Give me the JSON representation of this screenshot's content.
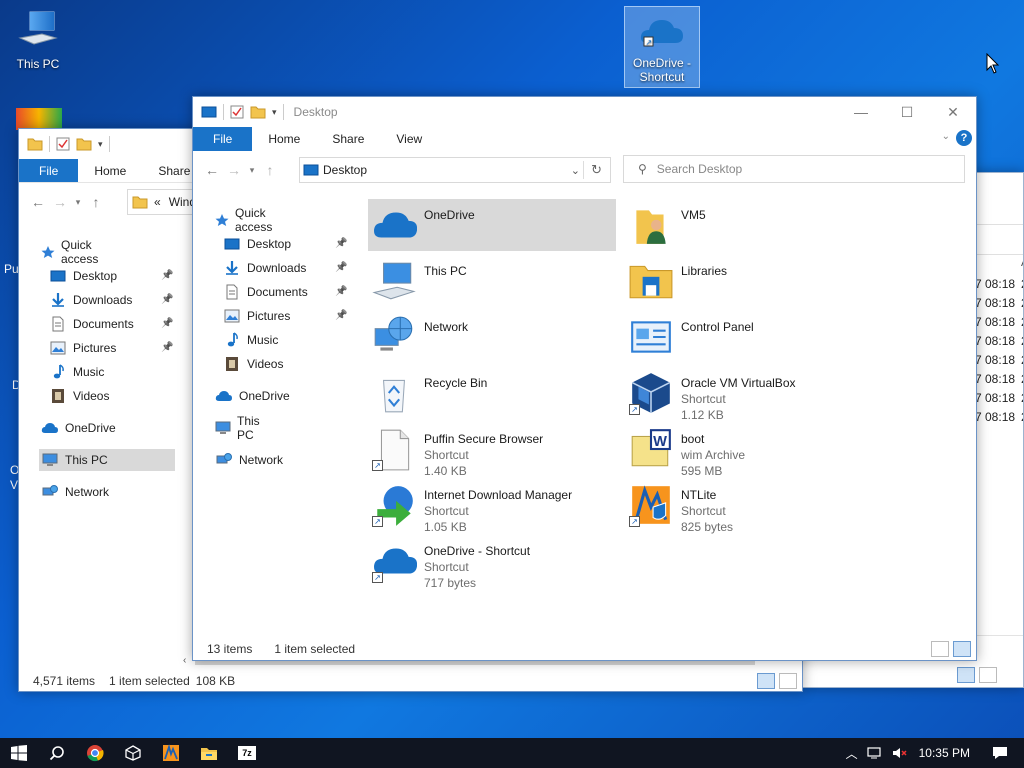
{
  "desktop": {
    "icons": [
      {
        "label": "This PC",
        "icon": "monitor-icon"
      },
      {
        "label": "OneDrive - Shortcut",
        "icon": "cloud-icon"
      }
    ],
    "partial_labels": [
      "Pu",
      "D",
      "O",
      "V"
    ]
  },
  "back_window": {
    "tabs": [
      "File",
      "Home",
      "Share"
    ],
    "address": "Wind",
    "address_prefix": "«",
    "nav": {
      "quick_access": "Quick access",
      "items": [
        {
          "label": "Desktop",
          "pinned": true
        },
        {
          "label": "Downloads",
          "pinned": true
        },
        {
          "label": "Documents",
          "pinned": true
        },
        {
          "label": "Pictures",
          "pinned": true
        },
        {
          "label": "Music",
          "pinned": false
        },
        {
          "label": "Videos",
          "pinned": false
        }
      ],
      "onedrive": "OneDrive",
      "this_pc": "This PC",
      "network": "Network"
    },
    "status": {
      "count": "4,571 items",
      "selected": "1 item selected",
      "size": "108 KB"
    }
  },
  "right_window": {
    "header_partial": "A",
    "times": [
      "7 08:18",
      "7 08:18",
      "7 08:18",
      "7 08:18",
      "7 08:18",
      "7 08:18",
      "7 08:18",
      "7 08:18"
    ],
    "tails": [
      "2",
      "2",
      "2",
      "2",
      "2",
      "2",
      "2",
      "2"
    ]
  },
  "main_window": {
    "title": "Desktop",
    "tabs": {
      "file": "File",
      "home": "Home",
      "share": "Share",
      "view": "View"
    },
    "help": "?",
    "address": "Desktop",
    "search_placeholder": "Search Desktop",
    "nav": {
      "quick_access": "Quick access",
      "items": [
        {
          "label": "Desktop",
          "pinned": true
        },
        {
          "label": "Downloads",
          "pinned": true
        },
        {
          "label": "Documents",
          "pinned": true
        },
        {
          "label": "Pictures",
          "pinned": true
        },
        {
          "label": "Music",
          "pinned": false
        },
        {
          "label": "Videos",
          "pinned": false
        }
      ],
      "onedrive": "OneDrive",
      "this_pc": "This PC",
      "network": "Network"
    },
    "items_left": [
      {
        "name": "OneDrive",
        "type": "",
        "size": "",
        "icon": "cloud-icon",
        "selected": true
      },
      {
        "name": "This PC",
        "type": "",
        "size": "",
        "icon": "monitor-icon"
      },
      {
        "name": "Network",
        "type": "",
        "size": "",
        "icon": "network-icon"
      },
      {
        "name": "Recycle Bin",
        "type": "",
        "size": "",
        "icon": "recycle-bin-icon"
      },
      {
        "name": "Puffin Secure Browser",
        "type": "Shortcut",
        "size": "1.40 KB",
        "icon": "blank-file-icon",
        "shortcut": true
      },
      {
        "name": "Internet Download Manager",
        "type": "Shortcut",
        "size": "1.05 KB",
        "icon": "idm-icon",
        "shortcut": true
      },
      {
        "name": "OneDrive - Shortcut",
        "type": "Shortcut",
        "size": "717 bytes",
        "icon": "cloud-icon",
        "shortcut": true
      }
    ],
    "items_right": [
      {
        "name": "VM5",
        "type": "",
        "size": "",
        "icon": "user-folder-icon"
      },
      {
        "name": "Libraries",
        "type": "",
        "size": "",
        "icon": "libraries-icon"
      },
      {
        "name": "Control Panel",
        "type": "",
        "size": "",
        "icon": "control-panel-icon"
      },
      {
        "name": "Oracle VM VirtualBox",
        "type": "Shortcut",
        "size": "1.12 KB",
        "icon": "virtualbox-icon",
        "shortcut": true
      },
      {
        "name": "boot",
        "type": "wim Archive",
        "size": "595 MB",
        "icon": "wim-archive-icon"
      },
      {
        "name": "NTLite",
        "type": "Shortcut",
        "size": "825 bytes",
        "icon": "ntlite-icon",
        "shortcut": true
      }
    ],
    "status": {
      "count": "13 items",
      "selected": "1 item selected"
    }
  },
  "taskbar": {
    "apps": [
      "start-icon",
      "search-icon",
      "chrome-icon",
      "virtualbox-icon",
      "ntlite-icon",
      "file-explorer-icon",
      "7zip-icon"
    ],
    "seven_zip_label": "7z",
    "clock": "10:35 PM"
  },
  "colors": {
    "accent": "#1a73c8",
    "selection": "#d9d9d9",
    "taskbar": "#101521",
    "folder": "#f2c44d"
  }
}
